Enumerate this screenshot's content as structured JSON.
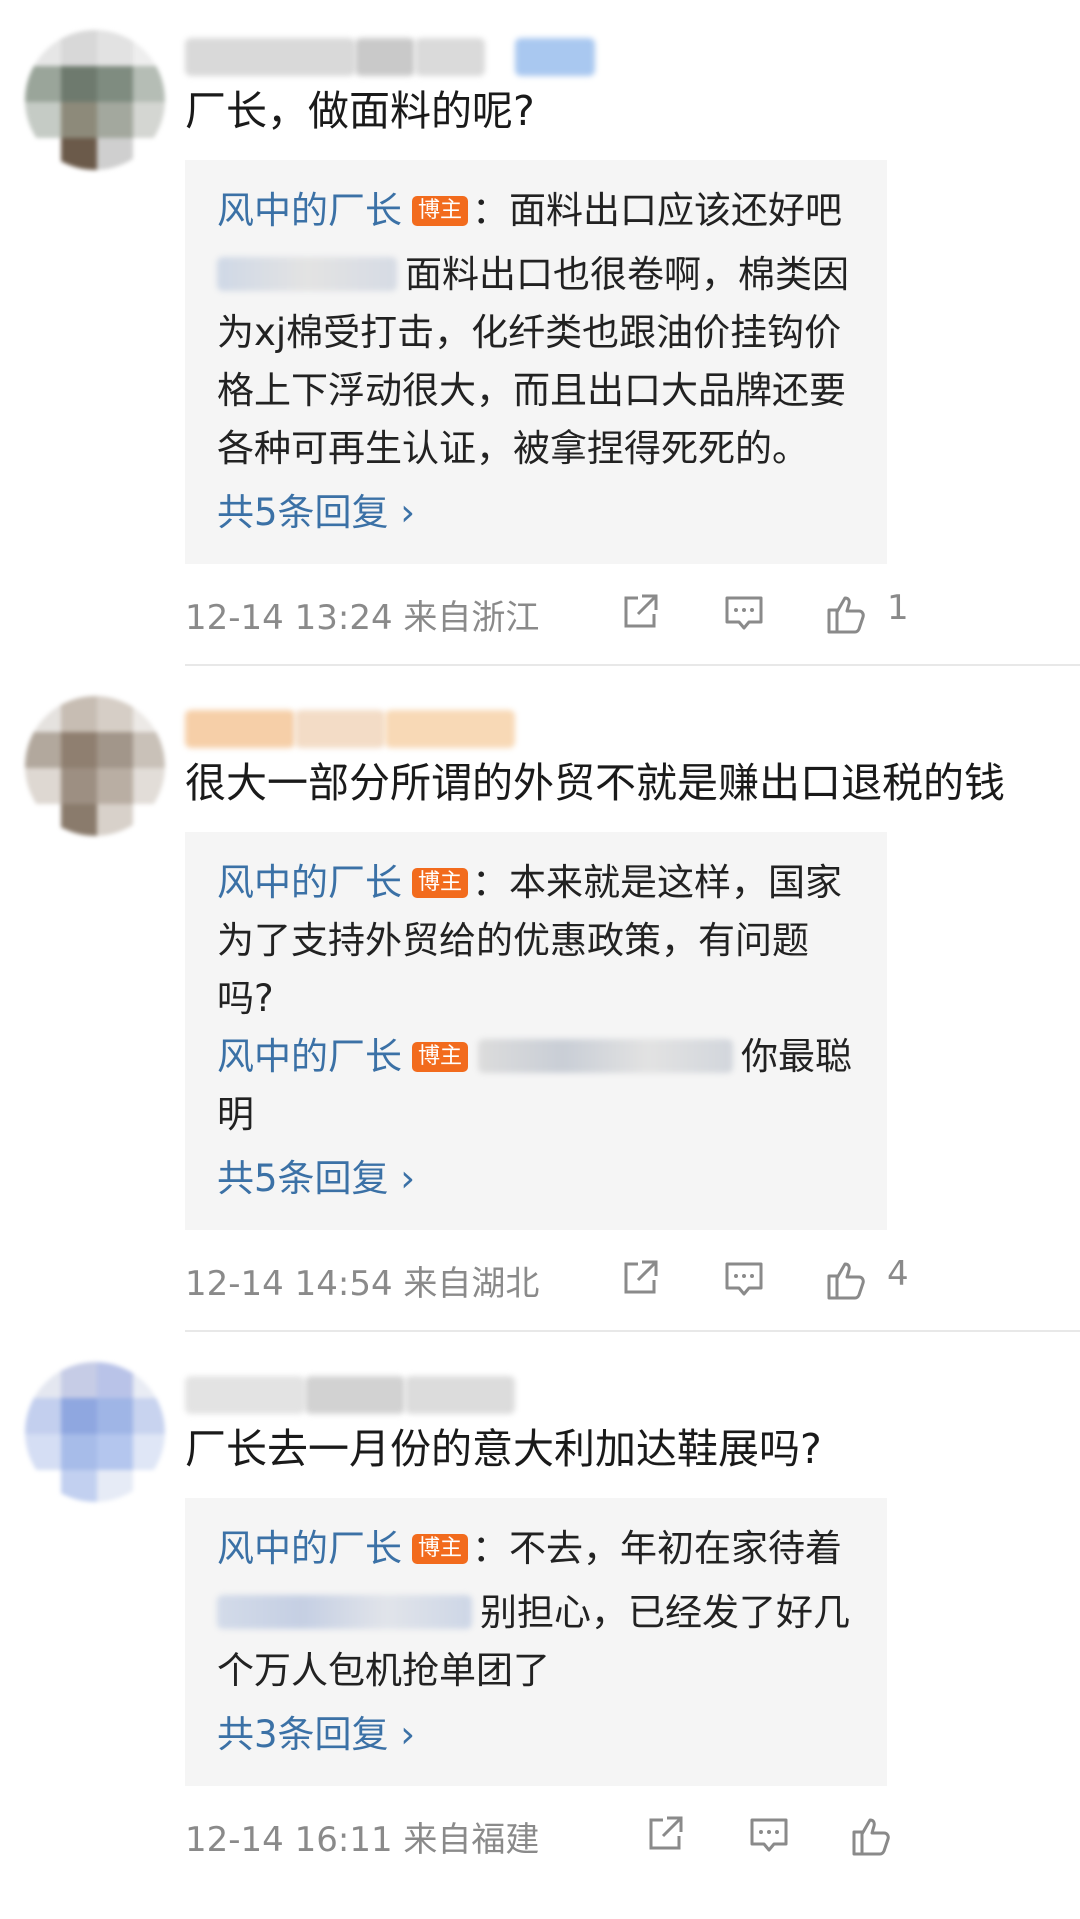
{
  "comments": [
    {
      "text": "厂长，做面料的呢?",
      "reply_author": "风中的厂长",
      "badge": "博主",
      "reply_text": "：面料出口应该还好吧",
      "sub_reply_text": "面料出口也很卷啊，棉类因为xj棉受打击，化纤类也跟油价挂钩价格上下浮动很大，而且出口大品牌还要各种可再生认证，被拿捏得死死的。",
      "more_replies": "共5条回复 ›",
      "time": "12-14 13:24",
      "location": "来自浙江",
      "likes": "1"
    },
    {
      "text": "很大一部分所谓的外贸不就是赚出口退税的钱",
      "reply_author": "风中的厂长",
      "badge": "博主",
      "reply_text": "：本来就是这样，国家为了支持外贸给的优惠政策，有问题吗?",
      "sub_reply_author": "风中的厂长",
      "sub_reply_badge": "博主",
      "sub_reply_text": "你最聪明",
      "more_replies": "共5条回复 ›",
      "time": "12-14 14:54",
      "location": "来自湖北",
      "likes": "4"
    },
    {
      "text": "厂长去一月份的意大利加达鞋展吗?",
      "reply_author": "风中的厂长",
      "badge": "博主",
      "reply_text": "：不去，年初在家待着",
      "sub_reply_text": "别担心，已经发了好几个万人包机抢单团了",
      "more_replies": "共3条回复 ›",
      "time": "12-14 16:11",
      "location": "来自福建",
      "likes": ""
    }
  ],
  "icons": {
    "share": "share-icon",
    "comment": "comment-icon",
    "like": "thumbs-up-icon"
  },
  "colors": {
    "link": "#3b71a6",
    "badge": "#f26b1d",
    "meta": "#8a8a8a",
    "reply_bg": "#f5f5f5"
  }
}
